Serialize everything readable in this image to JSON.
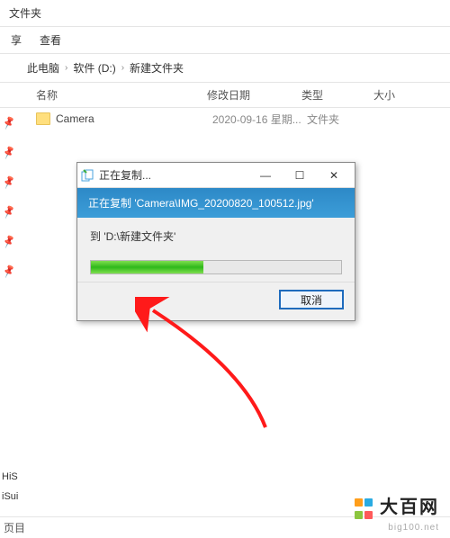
{
  "window": {
    "title": "文件夹"
  },
  "toolbar": {
    "share": "享",
    "view": "查看"
  },
  "breadcrumb": {
    "pc": "此电脑",
    "drive": "软件 (D:)",
    "folder": "新建文件夹"
  },
  "columns": {
    "name": "名称",
    "date": "修改日期",
    "type": "类型",
    "size": "大小"
  },
  "row": {
    "name": "Camera",
    "date": "2020-09-16 星期...",
    "type": "文件夹"
  },
  "sidebar": {
    "items": [
      "HiS",
      "iSui"
    ],
    "status": "页目"
  },
  "dialog": {
    "title": "正在复制...",
    "band": "正在复制 'Camera\\IMG_20200820_100512.jpg'",
    "dest": "到 'D:\\新建文件夹'",
    "cancel": "取消"
  },
  "watermark": {
    "cn": "大百网",
    "en": "big100.net"
  }
}
